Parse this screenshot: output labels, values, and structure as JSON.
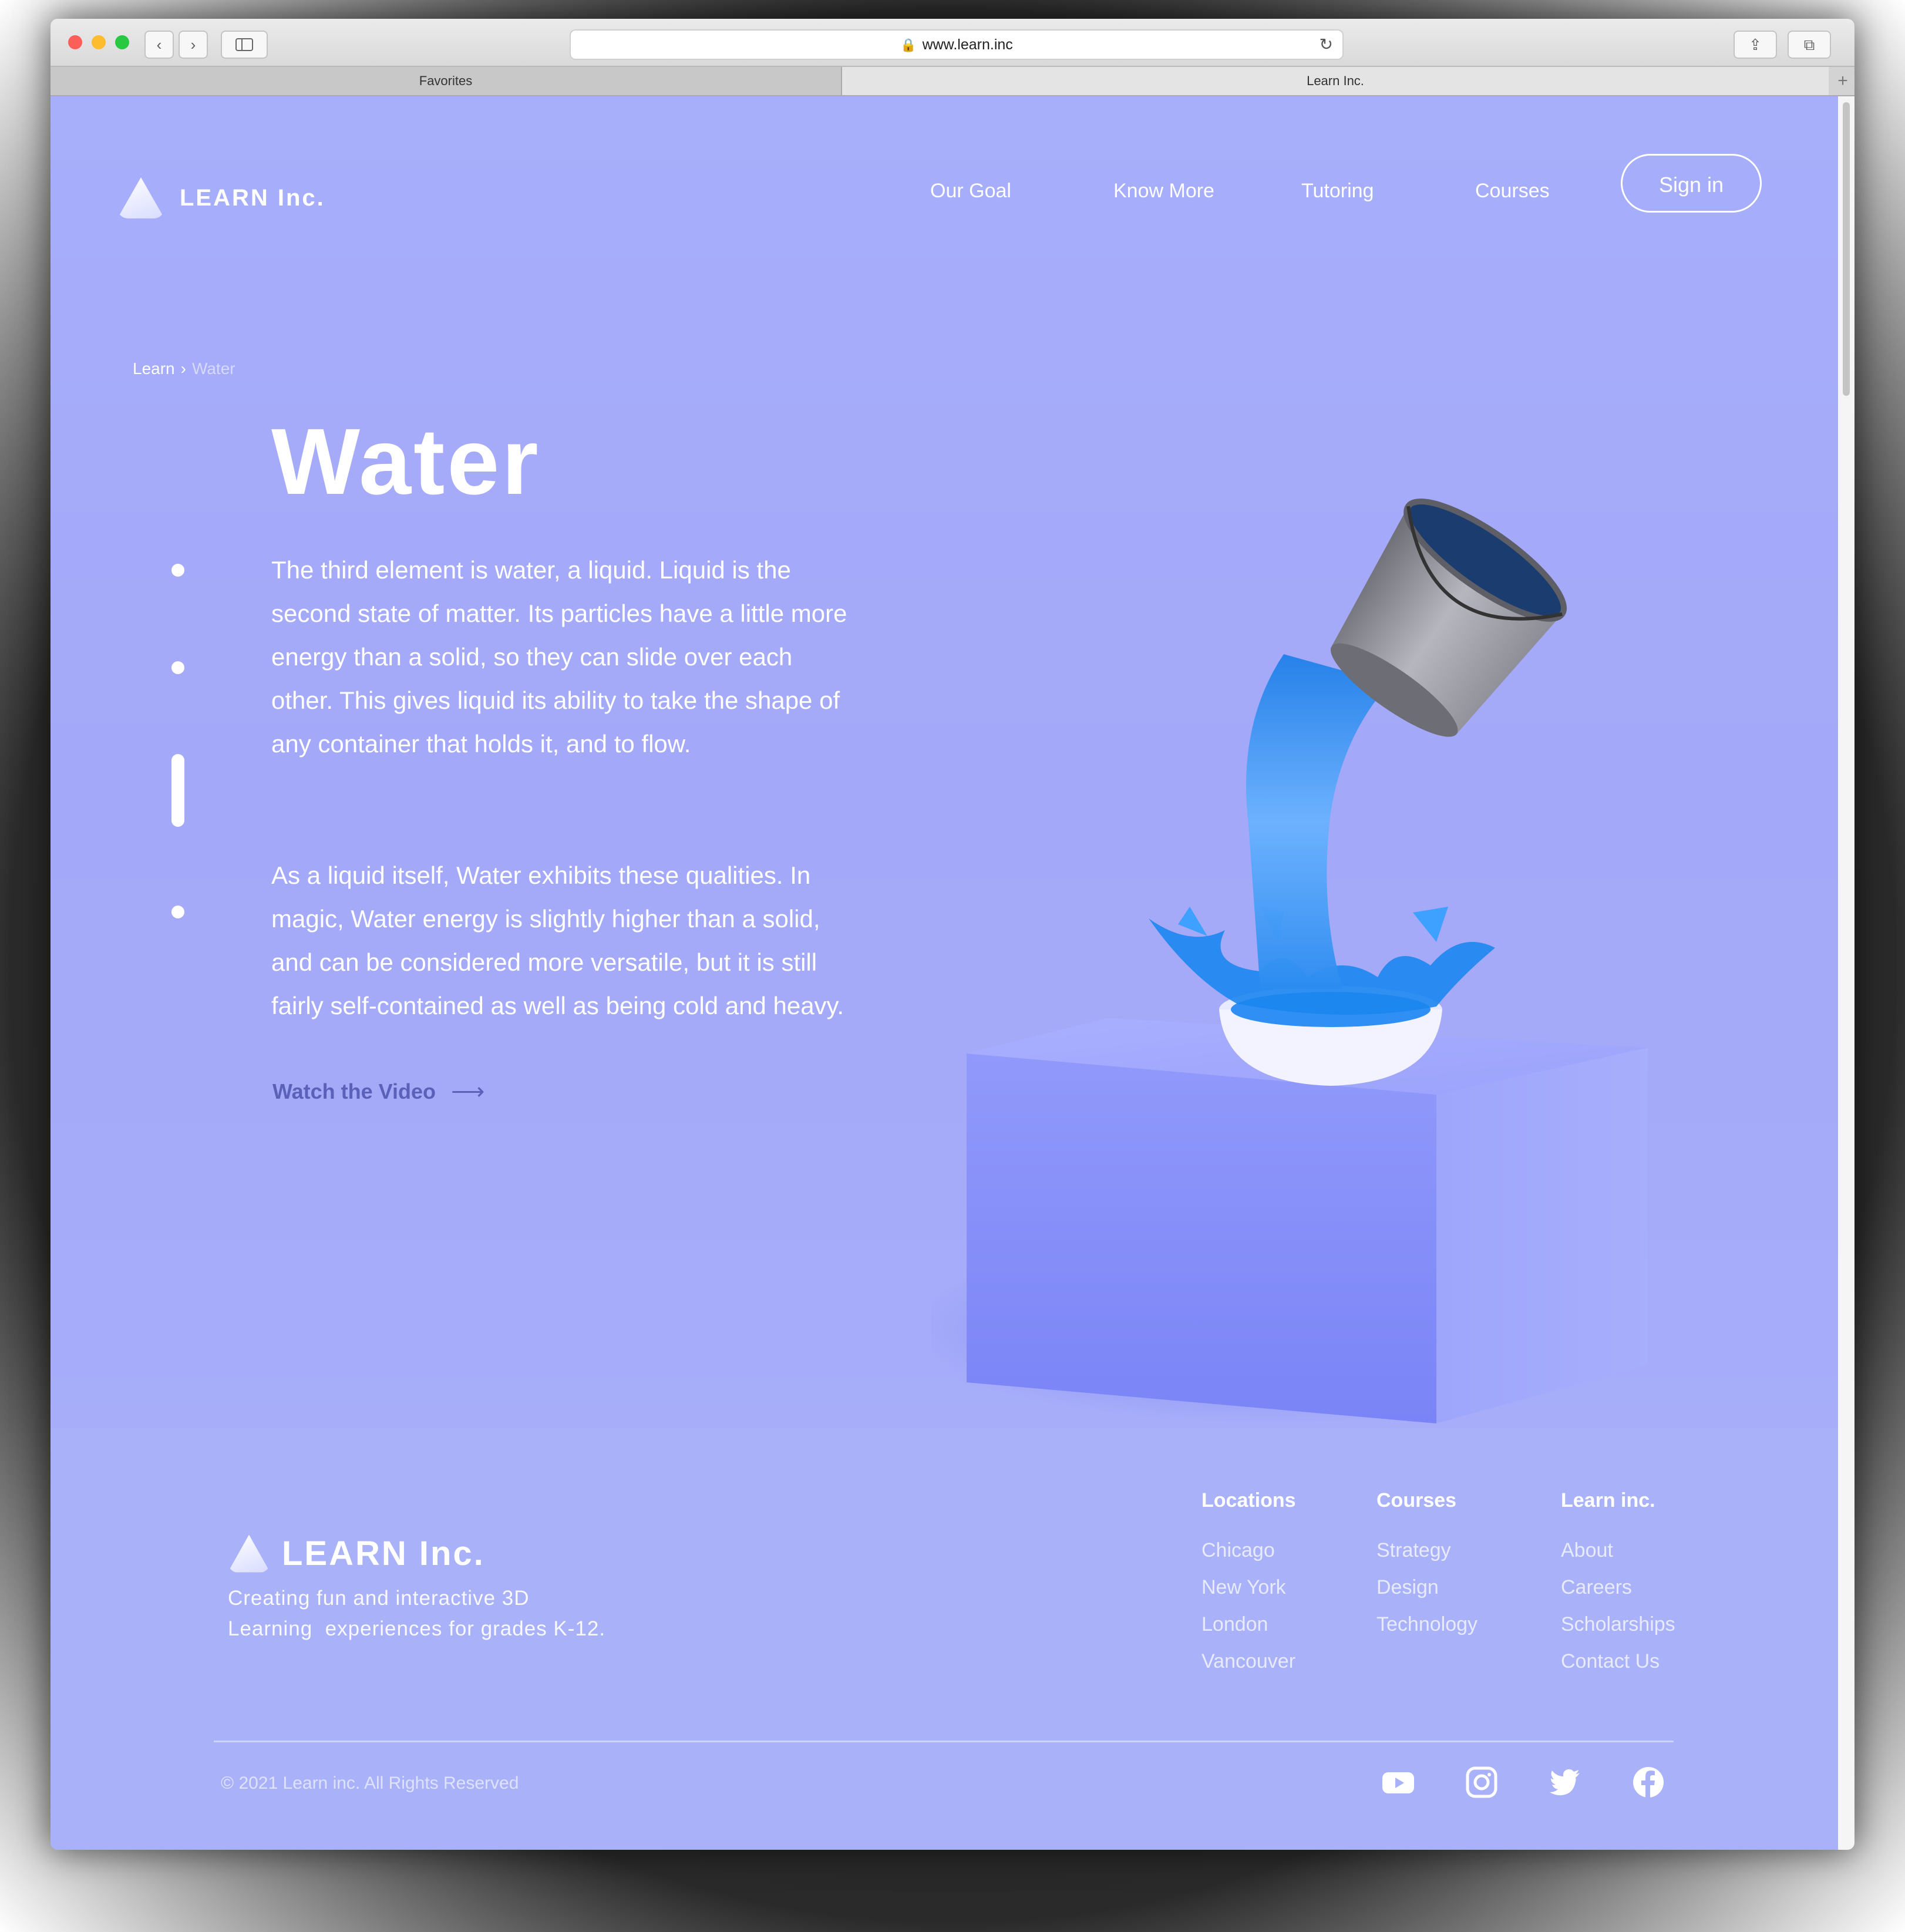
{
  "browser": {
    "url": "www.learn.inc",
    "tabs": [
      {
        "label": "Favorites"
      },
      {
        "label": "Learn Inc."
      }
    ]
  },
  "header": {
    "logo_text": "LEARN Inc.",
    "nav": [
      "Our Goal",
      "Know More",
      "Tutoring",
      "Courses"
    ],
    "signin_label": "Sign in"
  },
  "breadcrumb": {
    "root": "Learn",
    "current": "Water"
  },
  "hero": {
    "title": "Water",
    "paragraph1": "The third element is water, a liquid. Liquid is the second state of matter. Its particles have a little more energy than a solid, so they can slide over each other. This gives liquid its ability to take the shape of any container that holds it, and to flow.",
    "paragraph2": "As a liquid itself, Water exhibits these qualities. In magic, Water energy is slightly higher than a solid, and can be considered more versatile, but it is still fairly self-contained as well as being cold and heavy.",
    "cta": "Watch the Video",
    "pager": {
      "count": 4,
      "active_index": 2
    }
  },
  "footer": {
    "logo_text": "LEARN Inc.",
    "tagline_line1": "Creating fun and interactive 3D",
    "tagline_line2": "Learning  experiences for grades K-12.",
    "columns": [
      {
        "heading": "Locations",
        "links": [
          "Chicago",
          "New York",
          "London",
          "Vancouver"
        ]
      },
      {
        "heading": "Courses",
        "links": [
          "Strategy",
          "Design",
          "Technology"
        ]
      },
      {
        "heading": "Learn inc.",
        "links": [
          "About",
          "Careers",
          "Scholarships",
          "Contact Us"
        ]
      }
    ],
    "copyright": "© 2021 Learn inc. All Rights Reserved",
    "social": [
      "youtube-icon",
      "instagram-icon",
      "twitter-icon",
      "facebook-icon"
    ]
  },
  "colors": {
    "background": "#a7aefa",
    "cta": "#5b60b8",
    "text": "#ffffff"
  }
}
